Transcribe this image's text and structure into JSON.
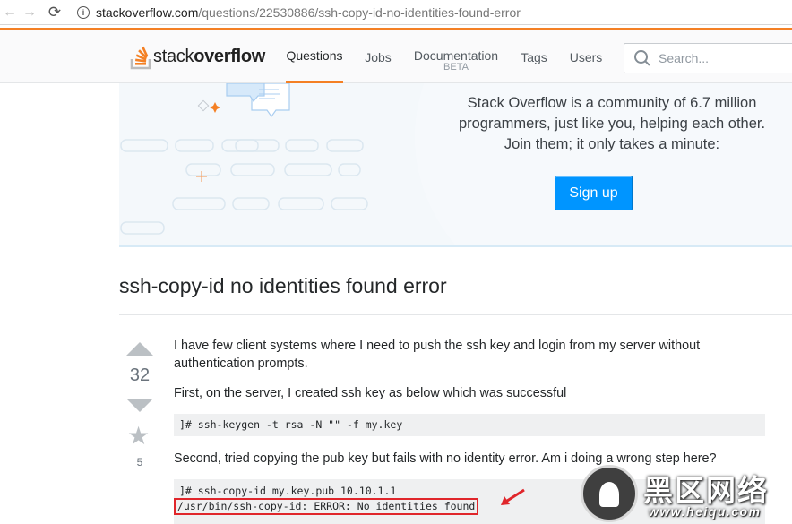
{
  "browser": {
    "url_host": "stackoverflow.com",
    "url_path": "/questions/22530886/ssh-copy-id-no-identities-found-error"
  },
  "header": {
    "logo_light": "stack",
    "logo_bold": "overflow",
    "tabs": [
      {
        "label": "Questions",
        "active": true
      },
      {
        "label": "Jobs"
      },
      {
        "label": "Documentation",
        "sub": "BETA"
      },
      {
        "label": "Tags"
      },
      {
        "label": "Users"
      }
    ],
    "search_placeholder": "Search..."
  },
  "hero": {
    "line1": "Stack Overflow is a community of 6.7 million",
    "line2": "programmers, just like you, helping each other.",
    "line3": "Join them; it only takes a minute:",
    "signup_label": "Sign up"
  },
  "question": {
    "title": "ssh-copy-id no identities found error",
    "votes": "32",
    "favorites": "5",
    "para1_line1": "I have few client systems where I need to push the ssh key and login from my server without",
    "para1_line2": "authentication prompts.",
    "para2": "First, on the server, I created ssh key as below which was successful",
    "code1": "]# ssh-keygen -t rsa -N \"\" -f my.key",
    "para3": "Second, tried copying the pub key but fails with no identity error. Am i doing a wrong step here?",
    "code2_line1": "]# ssh-copy-id my.key.pub 10.10.1.1",
    "code2_line2": "/usr/bin/ssh-copy-id: ERROR: No identities found"
  },
  "watermark": {
    "title": "黑区网络",
    "url": "www.heiqu.com"
  },
  "colors": {
    "accent": "#f48024",
    "signup": "#0095ff",
    "highlight_box": "#e0262b"
  }
}
